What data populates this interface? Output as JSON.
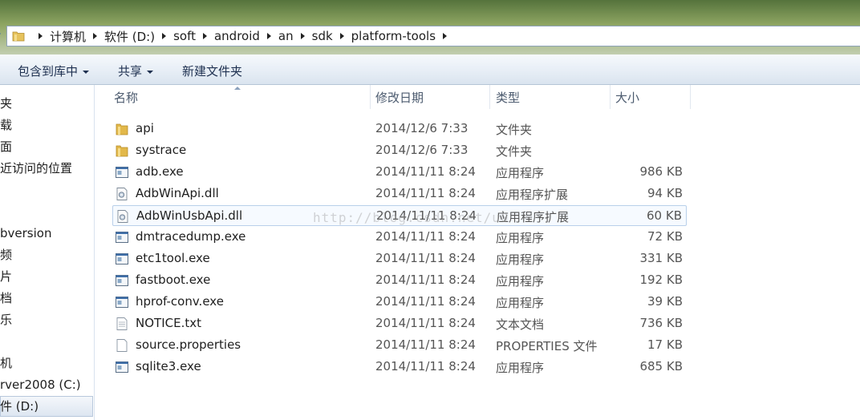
{
  "address": {
    "crumbs": [
      "计算机",
      "软件 (D:)",
      "soft",
      "android",
      "an",
      "sdk",
      "platform-tools"
    ]
  },
  "toolbar": {
    "include_label": "包含到库中",
    "share_label": "共享",
    "new_folder_label": "新建文件夹"
  },
  "nav": {
    "items": [
      "夹",
      "载",
      "面",
      "近访问的位置",
      "bversion",
      "频",
      "片",
      "档",
      "乐",
      "机",
      "rver2008 (C:)",
      "件 (D:)"
    ]
  },
  "columns": {
    "name": "名称",
    "date": "修改日期",
    "type": "类型",
    "size": "大小"
  },
  "files": [
    {
      "name": "api",
      "date": "2014/12/6 7:33",
      "type": "文件夹",
      "size": "",
      "icon": "folder-icon"
    },
    {
      "name": "systrace",
      "date": "2014/12/6 7:33",
      "type": "文件夹",
      "size": "",
      "icon": "folder-icon"
    },
    {
      "name": "adb.exe",
      "date": "2014/11/11 8:24",
      "type": "应用程序",
      "size": "986 KB",
      "icon": "exe-icon"
    },
    {
      "name": "AdbWinApi.dll",
      "date": "2014/11/11 8:24",
      "type": "应用程序扩展",
      "size": "94 KB",
      "icon": "dll-icon"
    },
    {
      "name": "AdbWinUsbApi.dll",
      "date": "2014/11/11 8:24",
      "type": "应用程序扩展",
      "size": "60 KB",
      "icon": "dll-icon"
    },
    {
      "name": "dmtracedump.exe",
      "date": "2014/11/11 8:24",
      "type": "应用程序",
      "size": "72 KB",
      "icon": "exe-icon"
    },
    {
      "name": "etc1tool.exe",
      "date": "2014/11/11 8:24",
      "type": "应用程序",
      "size": "331 KB",
      "icon": "exe-icon"
    },
    {
      "name": "fastboot.exe",
      "date": "2014/11/11 8:24",
      "type": "应用程序",
      "size": "192 KB",
      "icon": "exe-icon"
    },
    {
      "name": "hprof-conv.exe",
      "date": "2014/11/11 8:24",
      "type": "应用程序",
      "size": "39 KB",
      "icon": "exe-icon"
    },
    {
      "name": "NOTICE.txt",
      "date": "2014/11/11 8:24",
      "type": "文本文档",
      "size": "736 KB",
      "icon": "text-file-icon"
    },
    {
      "name": "source.properties",
      "date": "2014/11/11 8:24",
      "type": "PROPERTIES 文件",
      "size": "17 KB",
      "icon": "properties-file-icon"
    },
    {
      "name": "sqlite3.exe",
      "date": "2014/11/11 8:24",
      "type": "应用程序",
      "size": "685 KB",
      "icon": "exe-icon"
    }
  ],
  "watermark": "http://blog.csdn.net/u0"
}
